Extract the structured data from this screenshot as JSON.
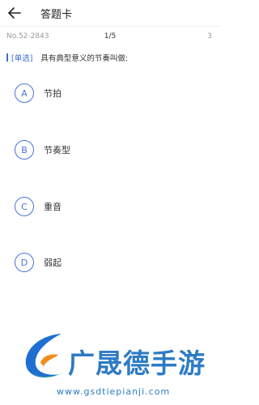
{
  "header": {
    "back_icon": "arrow-left-icon",
    "title": "答题卡"
  },
  "meta": {
    "question_no": "No.52-2843",
    "progress": "1/5",
    "total": "3"
  },
  "question": {
    "type": "[单选]",
    "text": "具有典型意义的节奏叫做:"
  },
  "options": [
    {
      "letter": "A",
      "text": "节拍"
    },
    {
      "letter": "B",
      "text": "节奏型"
    },
    {
      "letter": "C",
      "text": "重音"
    },
    {
      "letter": "D",
      "text": "弱起"
    }
  ],
  "watermark": {
    "brand": "广晟德手游",
    "url": "www.gsdtiepianji.com"
  },
  "colors": {
    "accent": "#4a73d6",
    "brand": "#2e7bc4"
  }
}
